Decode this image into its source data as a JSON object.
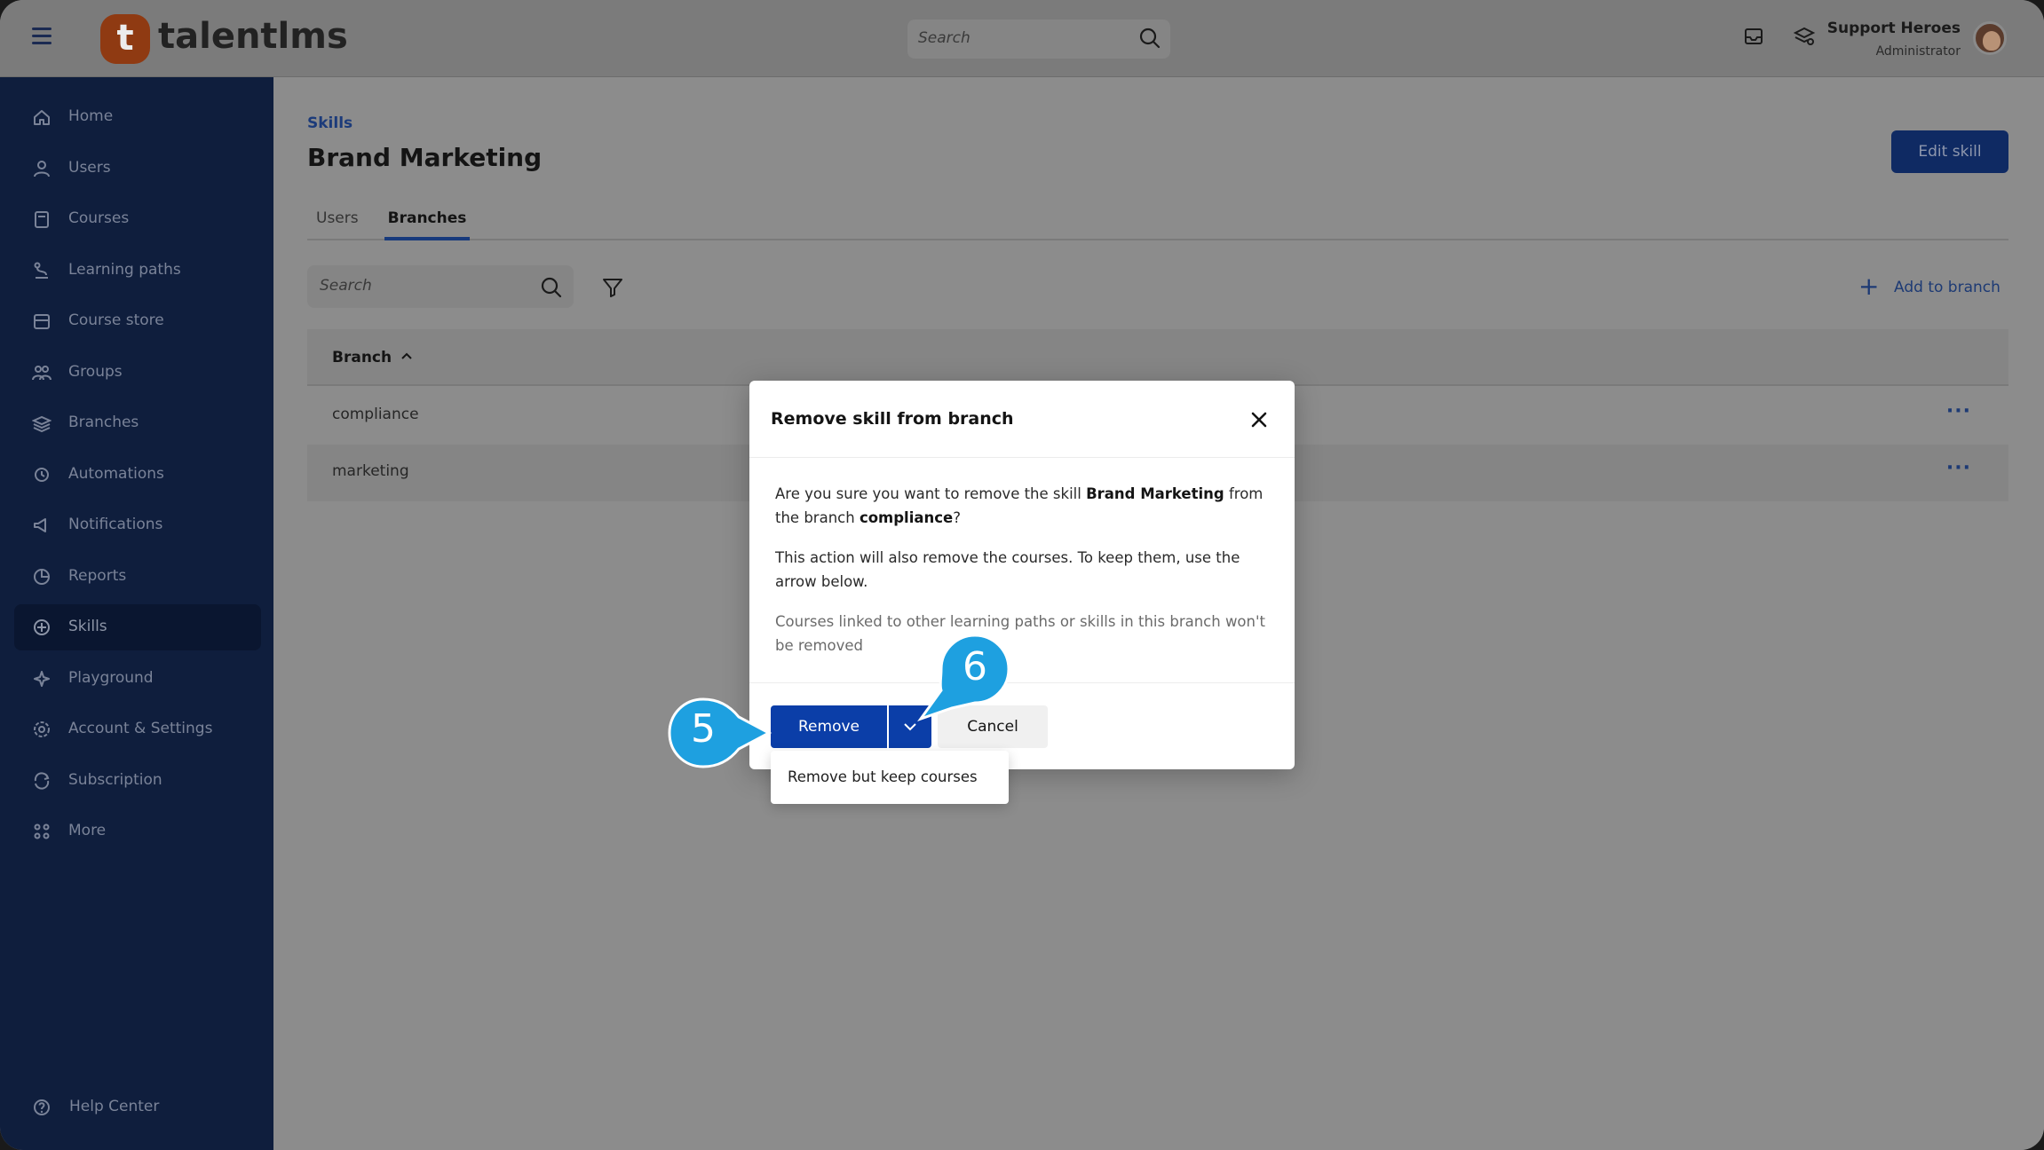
{
  "header": {
    "brand": "talentlms",
    "logo_letter": "t",
    "search_placeholder": "Search",
    "user_name": "Support Heroes",
    "user_role": "Administrator"
  },
  "sidebar": {
    "items": [
      {
        "label": "Home",
        "icon": "home-icon"
      },
      {
        "label": "Users",
        "icon": "user-icon"
      },
      {
        "label": "Courses",
        "icon": "book-icon"
      },
      {
        "label": "Learning paths",
        "icon": "path-icon"
      },
      {
        "label": "Course store",
        "icon": "store-icon"
      },
      {
        "label": "Groups",
        "icon": "groups-icon"
      },
      {
        "label": "Branches",
        "icon": "layers-icon"
      },
      {
        "label": "Automations",
        "icon": "automation-icon"
      },
      {
        "label": "Notifications",
        "icon": "megaphone-icon"
      },
      {
        "label": "Reports",
        "icon": "chart-pie-icon"
      },
      {
        "label": "Skills",
        "icon": "skills-icon",
        "active": true
      },
      {
        "label": "Playground",
        "icon": "sparkle-icon"
      },
      {
        "label": "Account & Settings",
        "icon": "gear-icon"
      },
      {
        "label": "Subscription",
        "icon": "subscription-icon"
      },
      {
        "label": "More",
        "icon": "grid-icon"
      }
    ],
    "help": "Help Center"
  },
  "main": {
    "breadcrumb": "Skills",
    "title": "Brand Marketing",
    "edit_button": "Edit skill",
    "tabs": [
      {
        "label": "Users",
        "active": false
      },
      {
        "label": "Branches",
        "active": true
      }
    ],
    "search_placeholder": "Search",
    "add_button": "Add to branch",
    "table": {
      "column": "Branch",
      "rows": [
        {
          "name": "compliance",
          "actions": "···"
        },
        {
          "name": "marketing",
          "actions": "···"
        }
      ]
    }
  },
  "modal": {
    "title": "Remove skill from branch",
    "body1_pre": "Are you sure you want to remove the skill ",
    "body1_skill": "Brand Marketing",
    "body1_mid": " from the branch ",
    "body1_branch": "compliance",
    "body1_post": "?",
    "body2": "This action will also remove the courses. To keep them, use the arrow below.",
    "body3": "Courses linked to other learning paths or skills in this branch won't be removed",
    "remove_button": "Remove",
    "cancel_button": "Cancel",
    "dropdown_option": "Remove but keep courses"
  },
  "callouts": {
    "step_5": "5",
    "step_6": "6",
    "color": "#1ea0e0"
  },
  "colors": {
    "sidebar_bg": "#0f1e3d",
    "primary_button": "#0b3ea8",
    "overlay_bg": "#8c8c8c",
    "brand_orange": "#8f3a12"
  }
}
